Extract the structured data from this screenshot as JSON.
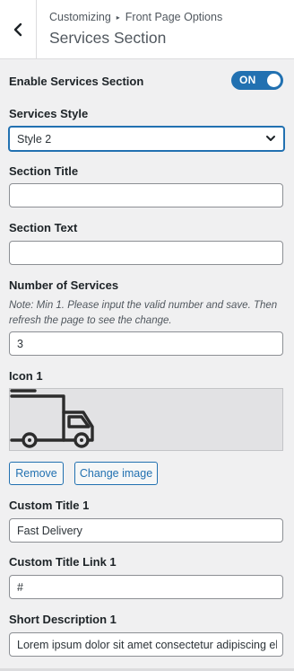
{
  "header": {
    "breadcrumb_root": "Customizing",
    "breadcrumb_parent": "Front Page Options",
    "title": "Services Section",
    "back_icon": "chevron-left-icon"
  },
  "enable": {
    "label": "Enable Services Section",
    "state": "ON"
  },
  "style": {
    "label": "Services Style",
    "value": "Style 2"
  },
  "section_title": {
    "label": "Section Title",
    "value": ""
  },
  "section_text": {
    "label": "Section Text",
    "value": ""
  },
  "number": {
    "label": "Number of Services",
    "note": "Note: Min 1. Please input the valid number and save. Then refresh the page to see the change.",
    "value": "3"
  },
  "icon1": {
    "label": "Icon 1",
    "image_icon": "delivery-truck-icon",
    "remove_label": "Remove",
    "change_label": "Change image"
  },
  "custom_title1": {
    "label": "Custom Title 1",
    "value": "Fast Delivery"
  },
  "custom_link1": {
    "label": "Custom Title Link 1",
    "value": "#"
  },
  "short_desc1": {
    "label": "Short Description 1",
    "value": "Lorem ipsum dolor sit amet consectetur adipiscing elit"
  },
  "colors": {
    "accent": "#2271b1",
    "background": "#f0f0f1",
    "text": "#1d2327"
  }
}
